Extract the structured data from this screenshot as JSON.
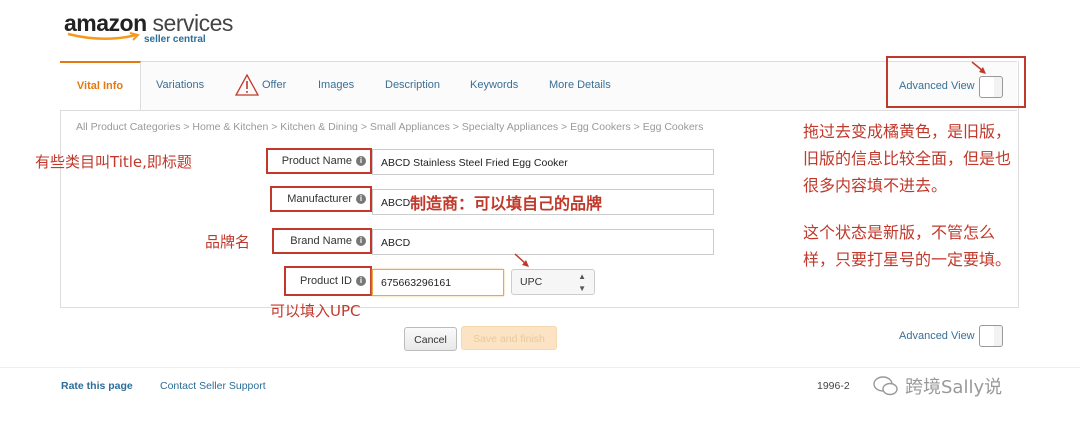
{
  "brand": {
    "name_a": "amazon",
    "name_b": " services",
    "sub": "seller central"
  },
  "tabs": [
    "Vital Info",
    "Variations",
    "Offer",
    "Images",
    "Description",
    "Keywords",
    "More Details"
  ],
  "advanced_view_label": "Advanced View",
  "breadcrumb": "All Product Categories > Home & Kitchen > Kitchen & Dining > Small Appliances > Specialty Appliances > Egg Cookers > Egg Cookers",
  "form": {
    "product_name": {
      "label": "Product Name",
      "value": "ABCD Stainless Steel Fried Egg Cooker"
    },
    "manufacturer": {
      "label": "Manufacturer",
      "value": "ABCD"
    },
    "brand_name": {
      "label": "Brand Name",
      "value": "ABCD"
    },
    "product_id": {
      "label": "Product ID",
      "value": "675663296161",
      "type_value": "UPC"
    }
  },
  "buttons": {
    "cancel": "Cancel",
    "save": "Save and finish"
  },
  "annotations": {
    "title_note": "有些类目叫Title,即标题",
    "manufacturer_note": "制造商：可以填自己的品牌",
    "brand_note": "品牌名",
    "upc_note": "可以填入UPC",
    "advanced_note_1": "拖过去变成橘黄色，是旧版，",
    "advanced_note_2": "旧版的信息比较全面，但是也",
    "advanced_note_3": "很多内容填不进去。",
    "new_note_1": "这个状态是新版，不管怎么",
    "new_note_2": "样，只要打星号的一定要填。"
  },
  "footer": {
    "rate": "Rate this page",
    "contact": "Contact Seller Support",
    "copyright": "1996-2",
    "watermark": "跨境Sally说"
  },
  "colors": {
    "accent": "#e47911",
    "link": "#3a6f96",
    "annotation": "#c0392b"
  }
}
